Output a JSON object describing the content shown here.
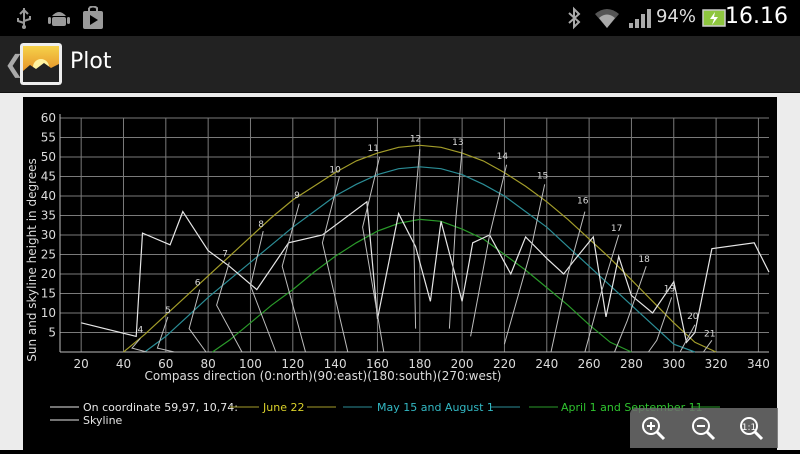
{
  "status_bar": {
    "battery_percent": "94%",
    "time": "16.16",
    "icons": [
      "usb-icon",
      "android-debug-icon",
      "play-store-icon",
      "bluetooth-icon",
      "wifi-icon",
      "signal-icon",
      "battery-charging-icon"
    ]
  },
  "action_bar": {
    "title": "Plot",
    "back_icon": "back-chevron-icon",
    "app_icon": "sun-horizon-app-icon"
  },
  "zoom_controls": {
    "icons": [
      "zoom-in-icon",
      "zoom-out-icon",
      "zoom-reset-icon"
    ]
  },
  "colors": {
    "june": "#a39d2a",
    "may_aug": "#2b8d96",
    "apr_sep": "#2a9a2a",
    "skyline": "#e6e6e6",
    "grid": "#7a7a7a",
    "text": "#dcdcdc"
  },
  "chart_data": {
    "type": "line",
    "title": "",
    "xlabel": "Compass direction (0:north)(90:east)(180:south)(270:west)",
    "ylabel": "Sun and skyline height in degrees",
    "xlim": [
      10,
      345
    ],
    "ylim": [
      0,
      60
    ],
    "x_ticks": [
      20,
      40,
      60,
      80,
      100,
      120,
      140,
      160,
      180,
      200,
      220,
      240,
      260,
      280,
      300,
      320,
      340
    ],
    "y_ticks": [
      5,
      10,
      15,
      20,
      25,
      30,
      35,
      40,
      45,
      50,
      55,
      60
    ],
    "grid": true,
    "legend_placement": "bottom",
    "legend": {
      "location_label": "On coordinate 59,97, 10,74:",
      "entries": [
        "June 22",
        "May 15 and August 1",
        "April 1 and September 11"
      ],
      "skyline_label": "Skyline"
    },
    "series": [
      {
        "name": "June 22",
        "x": [
          40,
          50,
          60,
          70,
          80,
          90,
          100,
          110,
          120,
          130,
          140,
          150,
          160,
          170,
          180,
          190,
          200,
          210,
          220,
          230,
          240,
          250,
          260,
          270,
          280,
          290,
          300,
          310,
          320
        ],
        "y": [
          0,
          4.5,
          9.5,
          14.5,
          19.5,
          24.5,
          29.5,
          34.5,
          39,
          42.5,
          46,
          49,
          51,
          52.5,
          53,
          52.5,
          51,
          49,
          46,
          42.5,
          38.5,
          34,
          29,
          24,
          18.5,
          13,
          7.5,
          2.5,
          0
        ]
      },
      {
        "name": "May 15 and August 1",
        "x": [
          50,
          60,
          70,
          80,
          90,
          100,
          110,
          120,
          130,
          140,
          150,
          160,
          170,
          180,
          190,
          200,
          210,
          220,
          230,
          240,
          250,
          260,
          270,
          280,
          290,
          300,
          310
        ],
        "y": [
          0,
          4,
          9,
          14,
          18.5,
          23,
          27.5,
          32,
          36,
          40,
          43,
          45.5,
          47,
          47.5,
          47,
          45.5,
          43,
          40,
          36,
          32,
          27,
          22,
          17,
          12,
          7,
          2,
          0
        ]
      },
      {
        "name": "April 1 and September 11",
        "x": [
          82,
          90,
          100,
          110,
          120,
          130,
          140,
          150,
          160,
          170,
          180,
          190,
          200,
          210,
          220,
          230,
          240,
          250,
          260,
          270,
          280
        ],
        "y": [
          0,
          3,
          7.5,
          12,
          16,
          20.5,
          24.5,
          28,
          31,
          33,
          34,
          33.5,
          31.5,
          29,
          25,
          21,
          16.5,
          12,
          7,
          2.5,
          0
        ]
      },
      {
        "name": "Skyline",
        "x": [
          20,
          46,
          49,
          62,
          68,
          80,
          90,
          103,
          118,
          134,
          155,
          160,
          170,
          178,
          185,
          190,
          200,
          205,
          213,
          223,
          230,
          240,
          248,
          253,
          262,
          268,
          274,
          280,
          290,
          300,
          306,
          310,
          318,
          338,
          345
        ],
        "y": [
          7.5,
          4,
          30.5,
          27.5,
          36,
          26,
          22,
          16,
          28,
          30,
          38.5,
          8.5,
          35.5,
          27,
          13,
          33.5,
          13,
          28,
          30,
          20,
          29.5,
          24,
          20,
          23.5,
          29.5,
          9,
          24.5,
          14.5,
          10,
          18,
          2.5,
          5,
          26.5,
          28,
          20.5
        ]
      }
    ],
    "hour_markers": [
      {
        "label": "4",
        "x": 48,
        "y": 4
      },
      {
        "label": "5",
        "x": 61,
        "y": 9
      },
      {
        "label": "6",
        "x": 75,
        "y": 16
      },
      {
        "label": "7",
        "x": 88,
        "y": 23.5
      },
      {
        "label": "8",
        "x": 105,
        "y": 31
      },
      {
        "label": "9",
        "x": 122,
        "y": 38.5
      },
      {
        "label": "10",
        "x": 140,
        "y": 45
      },
      {
        "label": "11",
        "x": 158,
        "y": 50.5
      },
      {
        "label": "12",
        "x": 178,
        "y": 53
      },
      {
        "label": "13",
        "x": 198,
        "y": 52
      },
      {
        "label": "14",
        "x": 219,
        "y": 48.5
      },
      {
        "label": "15",
        "x": 238,
        "y": 43.5
      },
      {
        "label": "16",
        "x": 257,
        "y": 37
      },
      {
        "label": "17",
        "x": 273,
        "y": 30
      },
      {
        "label": "18",
        "x": 286,
        "y": 22
      },
      {
        "label": "19",
        "x": 298,
        "y": 14.5
      },
      {
        "label": "20",
        "x": 309,
        "y": 7.5
      },
      {
        "label": "21",
        "x": 317,
        "y": 3
      }
    ],
    "hour_lines": [
      {
        "x": [
          48,
          44,
          51
        ],
        "y": [
          3.5,
          1,
          0
        ]
      },
      {
        "x": [
          61,
          56,
          64
        ],
        "y": [
          9,
          1,
          0
        ]
      },
      {
        "x": [
          76,
          71,
          79
        ],
        "y": [
          16,
          6,
          0
        ]
      },
      {
        "x": [
          90,
          84,
          96
        ],
        "y": [
          23,
          12,
          0
        ]
      },
      {
        "x": [
          106,
          100,
          112
        ],
        "y": [
          31,
          17,
          0
        ]
      },
      {
        "x": [
          123,
          115,
          126
        ],
        "y": [
          38,
          22,
          0
        ]
      },
      {
        "x": [
          142,
          134,
          146
        ],
        "y": [
          45,
          28,
          0
        ]
      },
      {
        "x": [
          161,
          153,
          163
        ],
        "y": [
          50,
          32,
          0
        ]
      },
      {
        "x": [
          180,
          177,
          178
        ],
        "y": [
          52,
          34,
          6
        ]
      },
      {
        "x": [
          200,
          197,
          194
        ],
        "y": [
          52,
          34,
          6
        ]
      },
      {
        "x": [
          221,
          213,
          204
        ],
        "y": [
          48,
          30,
          4
        ]
      },
      {
        "x": [
          239,
          232,
          220
        ],
        "y": [
          43,
          25,
          2
        ]
      },
      {
        "x": [
          258,
          250,
          242
        ],
        "y": [
          36,
          20,
          0
        ]
      },
      {
        "x": [
          274,
          265,
          258
        ],
        "y": [
          30,
          14,
          0
        ]
      },
      {
        "x": [
          287,
          278,
          272
        ],
        "y": [
          22,
          8,
          0
        ]
      },
      {
        "x": [
          299,
          292,
          288
        ],
        "y": [
          14,
          3,
          0
        ]
      },
      {
        "x": [
          310,
          303,
          302
        ],
        "y": [
          7,
          0,
          0
        ]
      },
      {
        "x": [
          318,
          314,
          312
        ],
        "y": [
          3,
          0,
          0
        ]
      }
    ]
  }
}
